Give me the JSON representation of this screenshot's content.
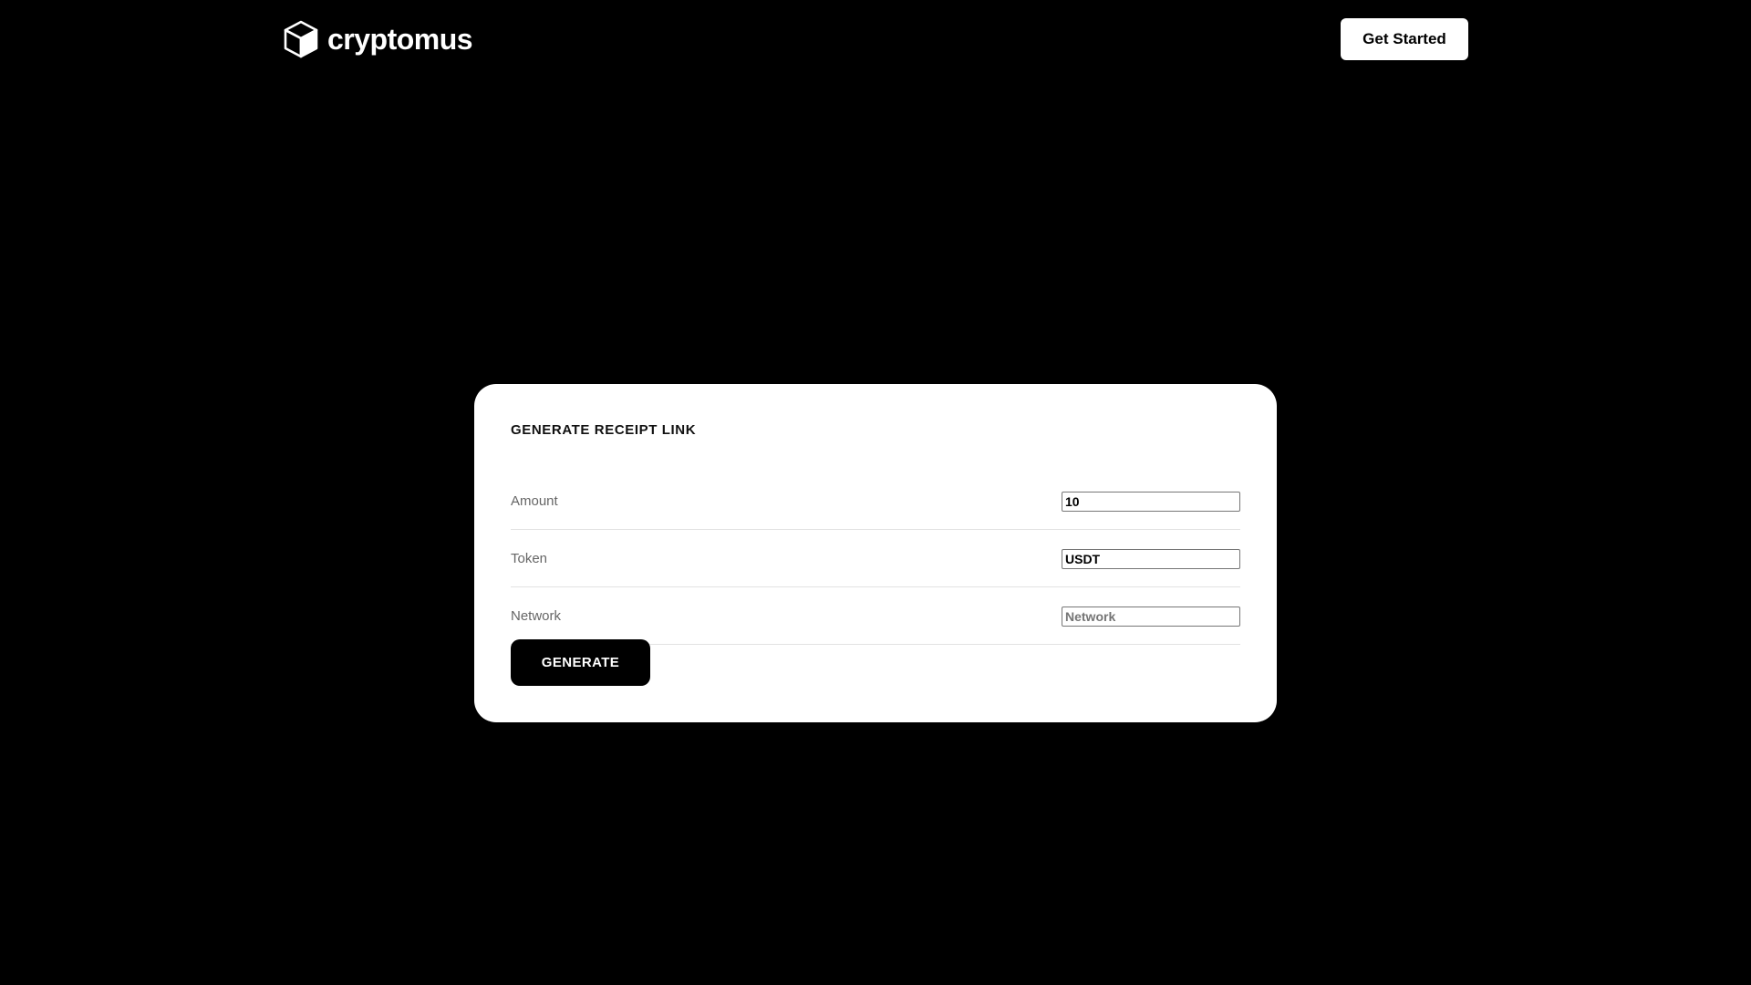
{
  "header": {
    "brand_name": "cryptomus",
    "logo_icon": "cube-icon",
    "cta_label": "Get Started"
  },
  "form": {
    "title": "GENERATE RECEIPT LINK",
    "fields": [
      {
        "label": "Amount",
        "value": "10",
        "placeholder": ""
      },
      {
        "label": "Token",
        "value": "USDT",
        "placeholder": ""
      },
      {
        "label": "Network",
        "value": "",
        "placeholder": "Network"
      }
    ],
    "submit_label": "GENERATE"
  },
  "colors": {
    "background": "#000000",
    "card": "#ffffff",
    "button_primary": "#000000",
    "button_header": "#ffffff"
  }
}
